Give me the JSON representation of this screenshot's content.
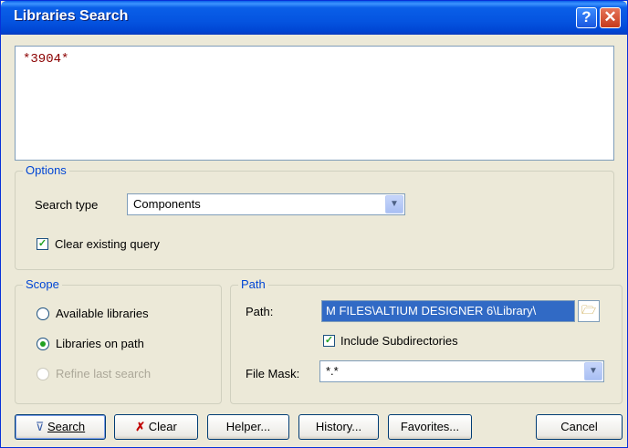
{
  "window": {
    "title": "Libraries Search"
  },
  "query": {
    "text": "*3904*"
  },
  "options": {
    "legend": "Options",
    "search_type_label": "Search type",
    "search_type_value": "Components",
    "clear_query_label": "Clear existing query",
    "clear_query_checked": true
  },
  "scope": {
    "legend": "Scope",
    "items": [
      {
        "label": "Available libraries",
        "selected": false,
        "enabled": true
      },
      {
        "label": "Libraries on path",
        "selected": true,
        "enabled": true
      },
      {
        "label": "Refine last search",
        "selected": false,
        "enabled": false
      }
    ]
  },
  "path": {
    "legend": "Path",
    "path_label": "Path:",
    "path_value": "M FILES\\ALTIUM DESIGNER 6\\Library\\",
    "include_sub_label": "Include Subdirectories",
    "include_sub_checked": true,
    "mask_label": "File Mask:",
    "mask_value": "*.*"
  },
  "buttons": {
    "search": "Search",
    "clear": "Clear",
    "helper": "Helper...",
    "history": "History...",
    "favorites": "Favorites...",
    "cancel": "Cancel"
  },
  "icons": [
    "help-icon",
    "close-icon",
    "chevron-down-icon",
    "folder-icon",
    "filter-icon",
    "clear-filter-icon"
  ]
}
